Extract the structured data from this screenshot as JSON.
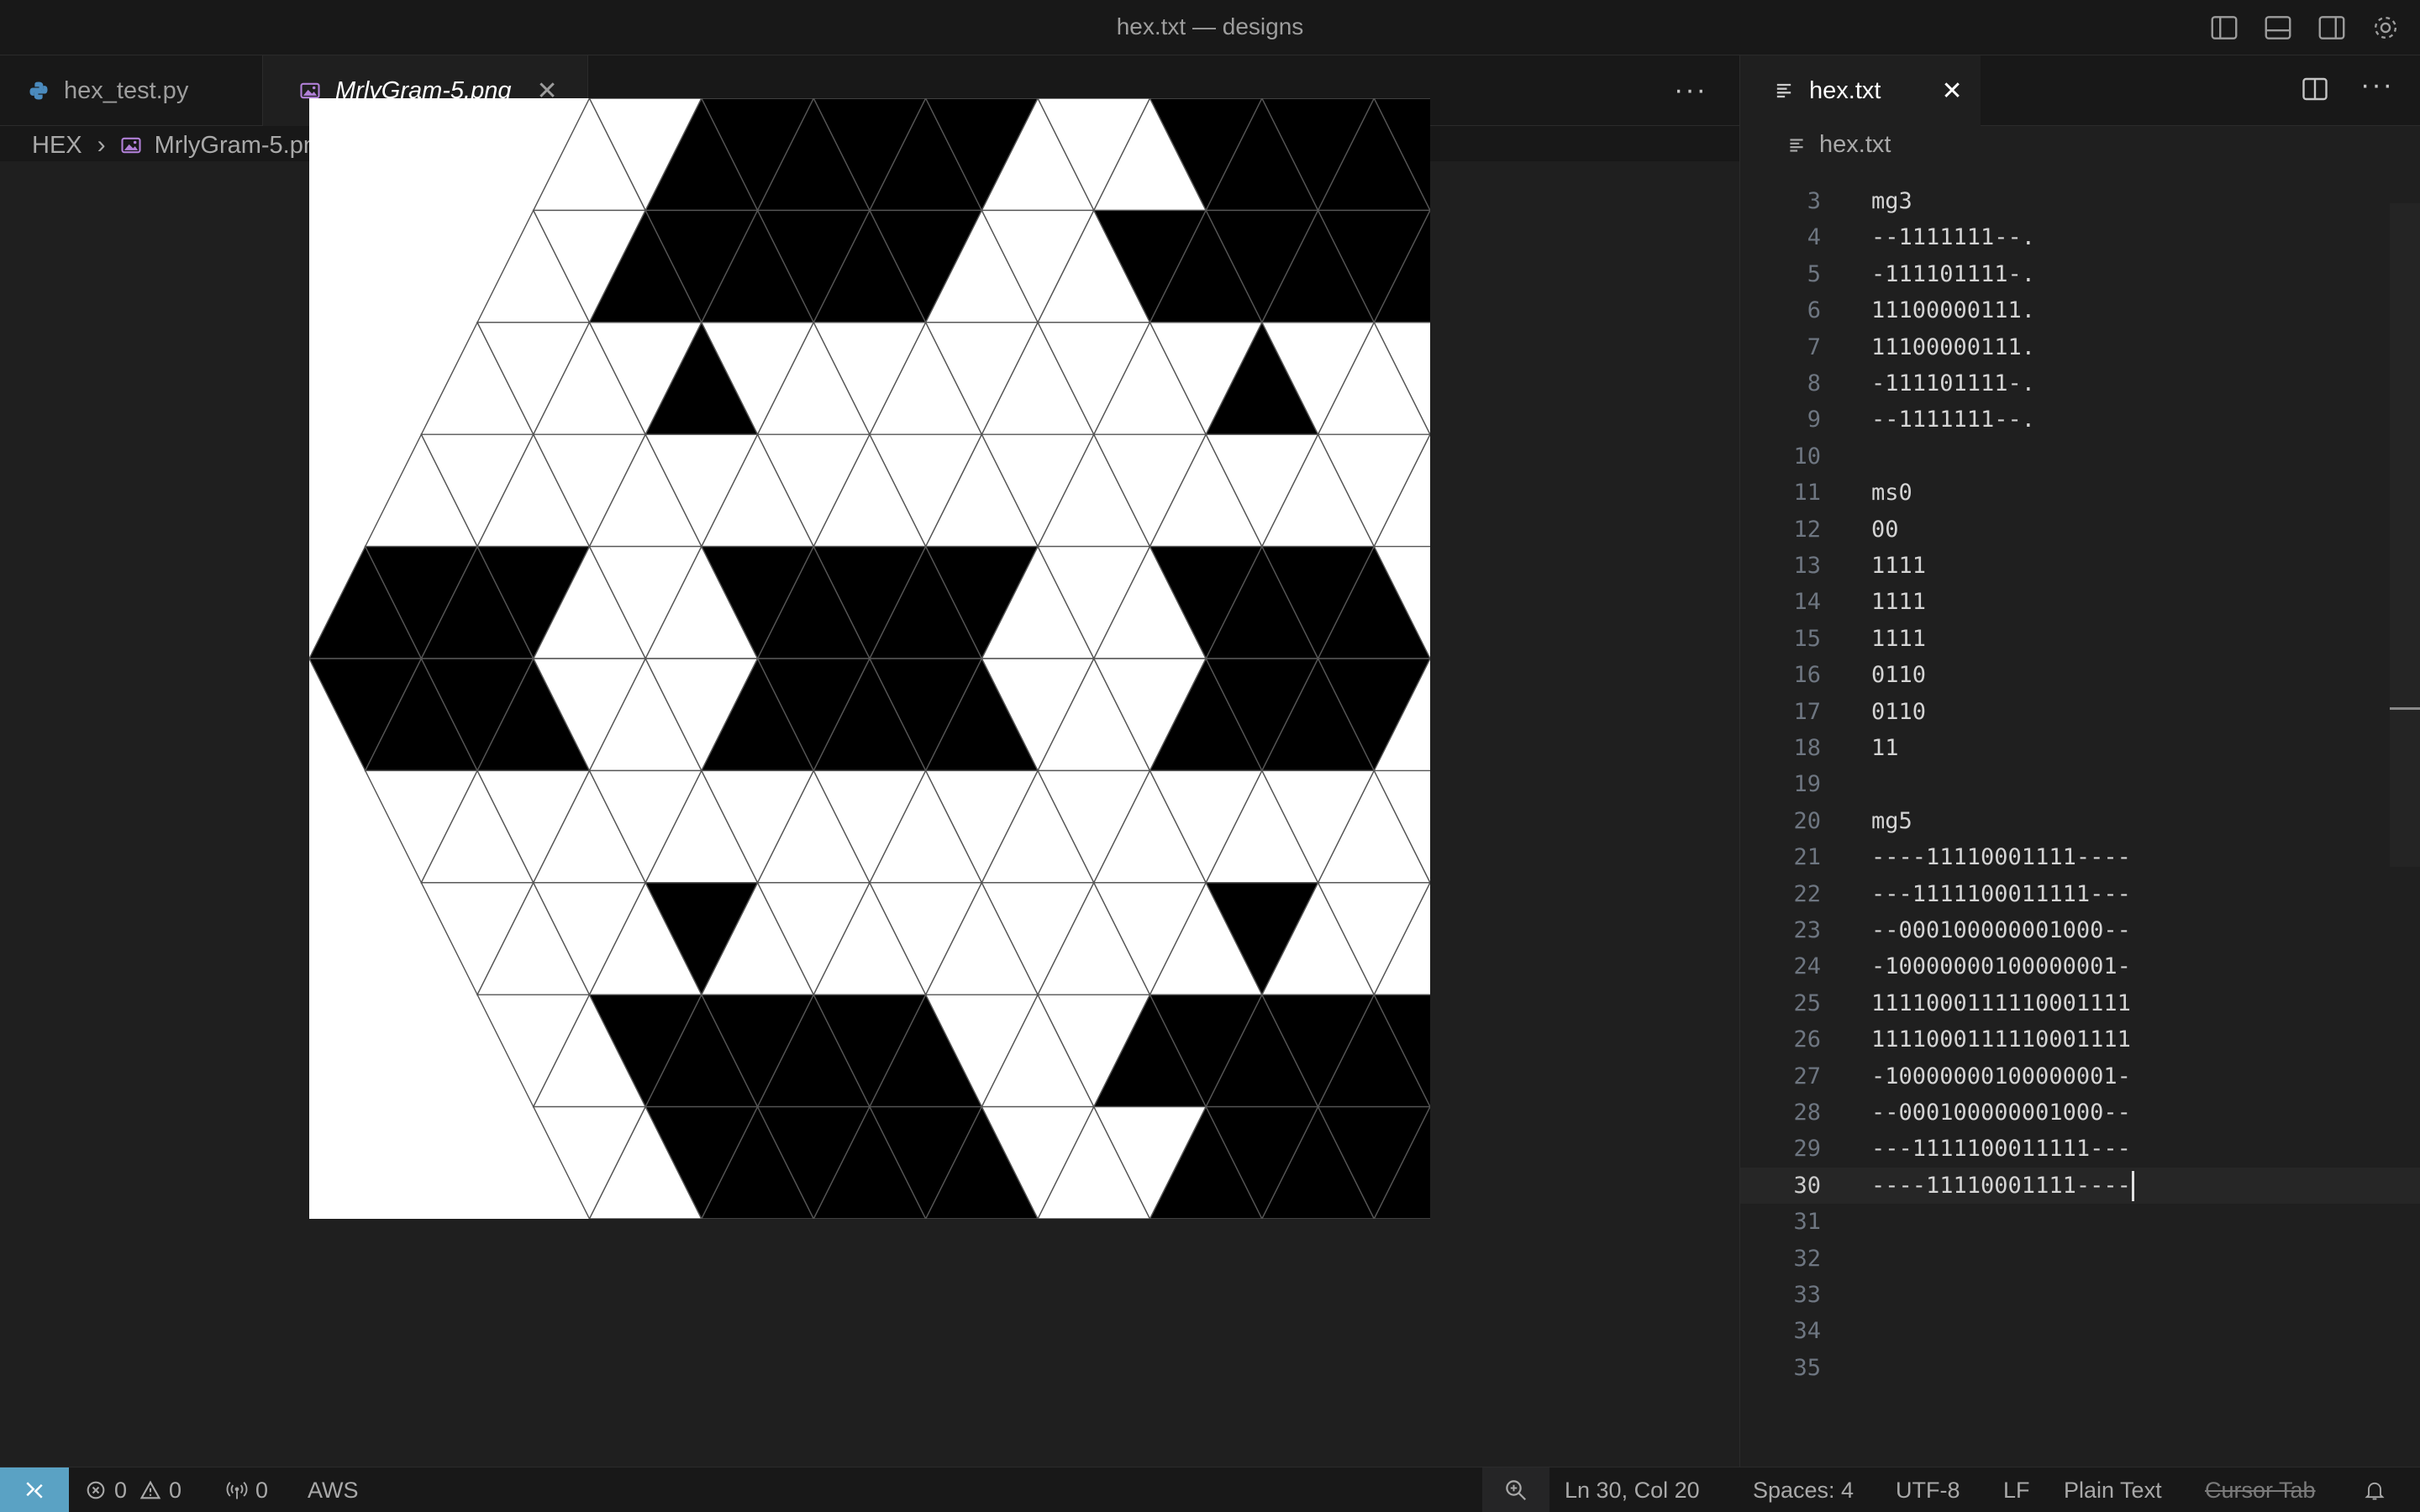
{
  "window": {
    "title": "hex.txt — designs"
  },
  "left_group": {
    "tabs": [
      {
        "label": "hex_test.py",
        "icon": "python-icon",
        "active": false
      },
      {
        "label": "MrlyGram-5.png",
        "icon": "image-icon",
        "active": true
      }
    ],
    "breadcrumb": {
      "folder": "HEX",
      "file": "MrlyGram-5.png"
    },
    "image": {
      "rows": [
        "0011111100011111100",
        "0011111100011111100",
        "0000100000000010000",
        "0000000000000000000",
        "1111000111110001111",
        "1111000111110001111",
        "0000000000000000000",
        "0000100000000010000",
        "0011111100011111100",
        "0011111100011111100"
      ],
      "colors": {
        "on": "#000000",
        "off": "#ffffff"
      }
    }
  },
  "right_group": {
    "tab": {
      "label": "hex.txt",
      "icon": "text-file-icon"
    },
    "breadcrumb": "hex.txt",
    "current_line": 30,
    "lines": [
      {
        "n": "3",
        "t": "mg3"
      },
      {
        "n": "4",
        "t": "--1111111--."
      },
      {
        "n": "5",
        "t": "-111101111-."
      },
      {
        "n": "6",
        "t": "11100000111."
      },
      {
        "n": "7",
        "t": "11100000111."
      },
      {
        "n": "8",
        "t": "-111101111-."
      },
      {
        "n": "9",
        "t": "--1111111--."
      },
      {
        "n": "10",
        "t": ""
      },
      {
        "n": "11",
        "t": "ms0"
      },
      {
        "n": "12",
        "t": "00"
      },
      {
        "n": "13",
        "t": "1111"
      },
      {
        "n": "14",
        "t": "1111"
      },
      {
        "n": "15",
        "t": "1111"
      },
      {
        "n": "16",
        "t": "0110"
      },
      {
        "n": "17",
        "t": "0110"
      },
      {
        "n": "18",
        "t": "11"
      },
      {
        "n": "19",
        "t": ""
      },
      {
        "n": "20",
        "t": "mg5"
      },
      {
        "n": "21",
        "t": "----11110001111----"
      },
      {
        "n": "22",
        "t": "---1111100011111---"
      },
      {
        "n": "23",
        "t": "--000100000001000--"
      },
      {
        "n": "24",
        "t": "-10000000100000001-"
      },
      {
        "n": "25",
        "t": "1111000111110001111"
      },
      {
        "n": "26",
        "t": "1111000111110001111"
      },
      {
        "n": "27",
        "t": "-10000000100000001-"
      },
      {
        "n": "28",
        "t": "--000100000001000--"
      },
      {
        "n": "29",
        "t": "---1111100011111---"
      },
      {
        "n": "30",
        "t": "----11110001111----"
      },
      {
        "n": "31",
        "t": ""
      },
      {
        "n": "32",
        "t": ""
      },
      {
        "n": "33",
        "t": ""
      },
      {
        "n": "34",
        "t": ""
      },
      {
        "n": "35",
        "t": ""
      }
    ]
  },
  "status": {
    "errors": "0",
    "warnings": "0",
    "ports": "0",
    "aws": "AWS",
    "position": "Ln 30, Col 20",
    "spaces": "Spaces: 4",
    "encoding": "UTF-8",
    "eol": "LF",
    "language": "Plain Text",
    "cursor_tab": "Cursor Tab"
  }
}
